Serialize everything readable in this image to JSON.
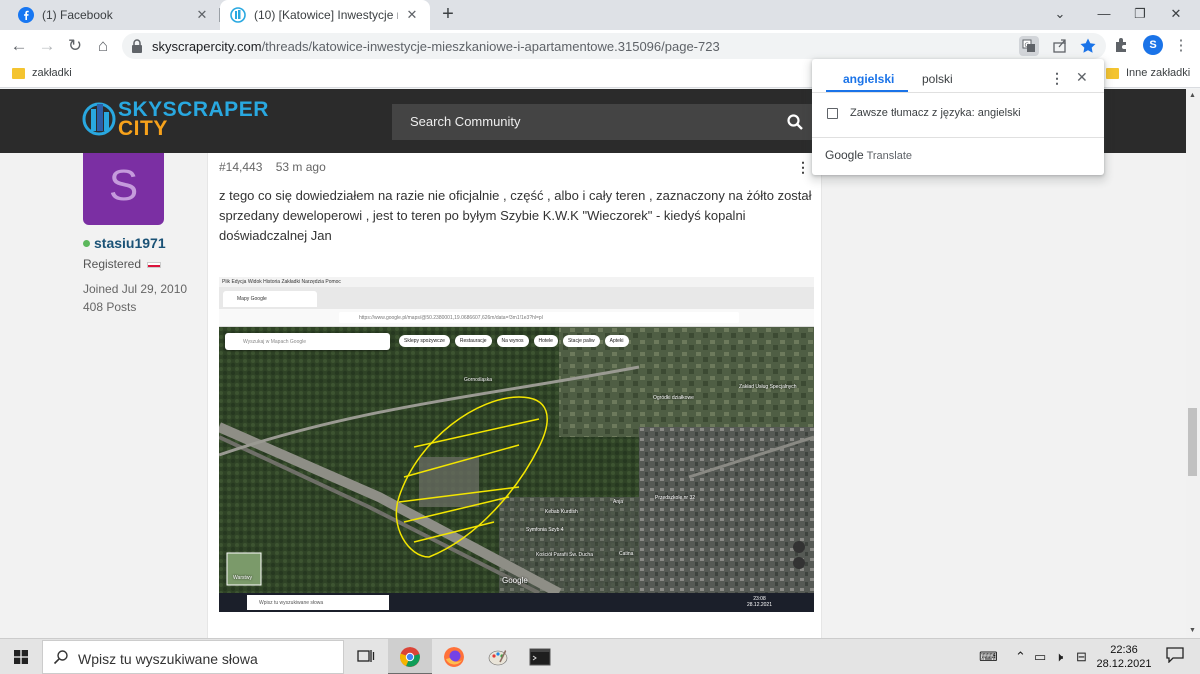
{
  "browser": {
    "tabs": [
      {
        "title": "(1) Facebook",
        "close": "✕"
      },
      {
        "title": "(10) [Katowice] Inwestycje mieszk",
        "close": "✕"
      }
    ],
    "new_tab": "+",
    "window_controls": {
      "minimize": "—",
      "maximize": "❐",
      "close": "✕",
      "tab_search": "⌄"
    },
    "url_domain": "skyscrapercity.com",
    "url_path": "/threads/katowice-inwestycje-mieszkaniowe-i-apartamentowe.315096/page-723",
    "profile_initial": "S",
    "bookmarks": {
      "left": "zakładki",
      "right": "Inne zakładki"
    }
  },
  "site": {
    "logo_top": "SKYSCRAPER",
    "logo_bottom": "CITY",
    "search_placeholder": "Search Community"
  },
  "post": {
    "author": {
      "avatar_letter": "S",
      "name": "stasiu1971",
      "role": "Registered",
      "joined": "Joined Jul 29, 2010",
      "posts": "408 Posts"
    },
    "number": "#14,443",
    "time": "53 m ago",
    "text": "z tego co się dowiedziałem na razie nie oficjalnie , część , albo i cały teren , zaznaczony na żółto został sprzedany deweloperowi , jest to teren po byłym Szybie K.W.K \"Wieczorek\" - kiedyś kopalni doświadczalnej Jan",
    "embed": {
      "menu": "Plik  Edycja  Widok  Historia  Zakładki  Narzędzia  Pomoc",
      "tab": "Mapy Google",
      "url": "https://www.google.pl/maps/@50.2380001,19.0686607,626m/data=!3m1!1e3?hl=pl",
      "map_search": "Wyszukaj w Mapach Google",
      "chips": [
        "Sklepy spożywcze",
        "Restauracje",
        "Na wynos",
        "Hotele",
        "Stacje paliw",
        "Apteki"
      ],
      "labels": {
        "gardens": "Ogródki działkowe",
        "street": "Gornośląska",
        "anja": "Anja",
        "kebab": "Kebab Kurdish",
        "symfonia": "Symfonia Szyb 4",
        "kosciol": "Kościół Parafii Św. Ducha",
        "catina": "Catina",
        "przedszkole": "Przedszkole nr 32",
        "zaklad": "Zakład Usług Specjalnych",
        "google": "Google",
        "satellite": "Warstwy"
      },
      "taskbar_search": "Wpisz tu wyszukiwane słowa",
      "clock_time": "23:08",
      "clock_date": "28.12.2021"
    }
  },
  "translate_popup": {
    "tab_source": "angielski",
    "tab_target": "polski",
    "checkbox_label": "Zawsze tłumacz z języka: angielski",
    "footer_brand": "Google",
    "footer_product": "Translate",
    "more": "⋮",
    "close": "✕"
  },
  "taskbar": {
    "search_placeholder": "Wpisz tu wyszukiwane słowa",
    "time": "22:36",
    "date": "28.12.2021"
  },
  "colors": {
    "accent_blue": "#1a73e8",
    "site_header": "#2b2b2b",
    "logo_blue": "#29a8e0",
    "logo_orange": "#f7a21b",
    "avatar_purple": "#7b2fa3",
    "highlight_yellow": "#f3e600"
  }
}
